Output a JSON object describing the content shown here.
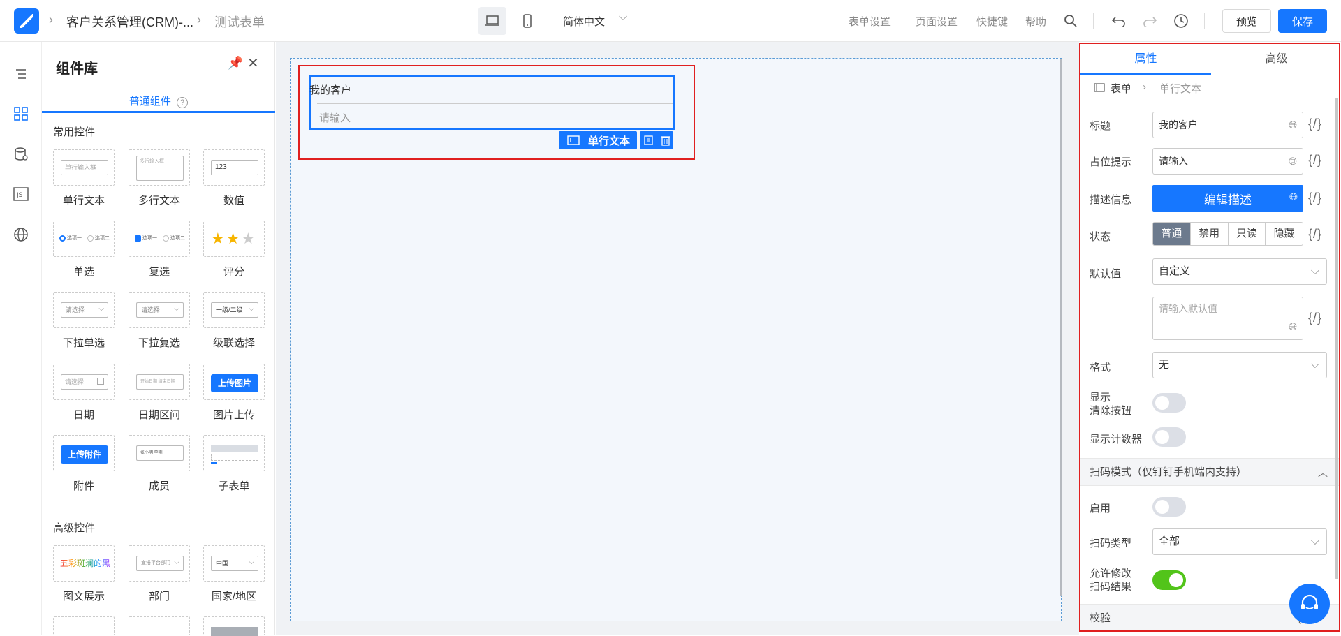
{
  "header": {
    "breadcrumb_app": "客户关系管理(CRM)-...",
    "breadcrumb_form": "测试表单",
    "language": "简体中文",
    "links": [
      "表单设置",
      "页面设置",
      "快捷键",
      "帮助"
    ],
    "preview_label": "预览",
    "save_label": "保存"
  },
  "library": {
    "title": "组件库",
    "tab": "普通组件",
    "section_common": "常用控件",
    "section_advanced": "高级控件",
    "items": [
      {
        "label": "单行文本",
        "preview": "单行输入框"
      },
      {
        "label": "多行文本",
        "preview": "多行输入框"
      },
      {
        "label": "数值",
        "preview": "123"
      },
      {
        "label": "单选",
        "preview_a": "选项一",
        "preview_b": "选项二"
      },
      {
        "label": "复选",
        "preview_a": "选项一",
        "preview_b": "选项二"
      },
      {
        "label": "评分",
        "preview": "★★★"
      },
      {
        "label": "下拉单选",
        "preview": "请选择"
      },
      {
        "label": "下拉复选",
        "preview": "请选择"
      },
      {
        "label": "级联选择",
        "preview": "一级/二级"
      },
      {
        "label": "日期",
        "preview": "请选择"
      },
      {
        "label": "日期区间",
        "preview": "开始日期 结束日期"
      },
      {
        "label": "图片上传",
        "preview": "上传图片"
      },
      {
        "label": "附件",
        "preview": "上传附件"
      },
      {
        "label": "成员",
        "preview": "张小明 李刚"
      },
      {
        "label": "子表单",
        "preview": ""
      },
      {
        "label": "图文展示",
        "preview": "五彩斑斓的黑"
      },
      {
        "label": "部门",
        "preview": "宜搭平台部门"
      },
      {
        "label": "国家/地区",
        "preview": "中国"
      }
    ]
  },
  "canvas": {
    "field_title": "我的客户",
    "field_placeholder": "请输入",
    "tag_label": "单行文本"
  },
  "props": {
    "tabs": [
      "属性",
      "高级"
    ],
    "crumb_root": "表单",
    "crumb_current": "单行文本",
    "labels": {
      "title": "标题",
      "placeholder": "占位提示",
      "desc": "描述信息",
      "state": "状态",
      "default": "默认值",
      "format": "格式",
      "show_clear_1": "显示",
      "show_clear_2": "清除按钮",
      "show_counter": "显示计数器",
      "enable": "启用",
      "scan_type": "扫码类型",
      "allow_edit_1": "允许修改",
      "allow_edit_2": "扫码结果"
    },
    "title_value": "我的客户",
    "placeholder_value": "请输入",
    "desc_button": "编辑描述",
    "states": [
      "普通",
      "禁用",
      "只读",
      "隐藏"
    ],
    "active_state": "普通",
    "default_select": "自定义",
    "default_textarea_placeholder": "请输入默认值",
    "format_select": "无",
    "scan_section": "扫码模式（仅钉钉手机端内支持）",
    "scan_type_select": "全部",
    "validate_section": "校验",
    "code_symbol": "{/}",
    "toggles": {
      "show_clear": false,
      "show_counter": false,
      "scan_enable": false,
      "allow_edit": true
    }
  }
}
